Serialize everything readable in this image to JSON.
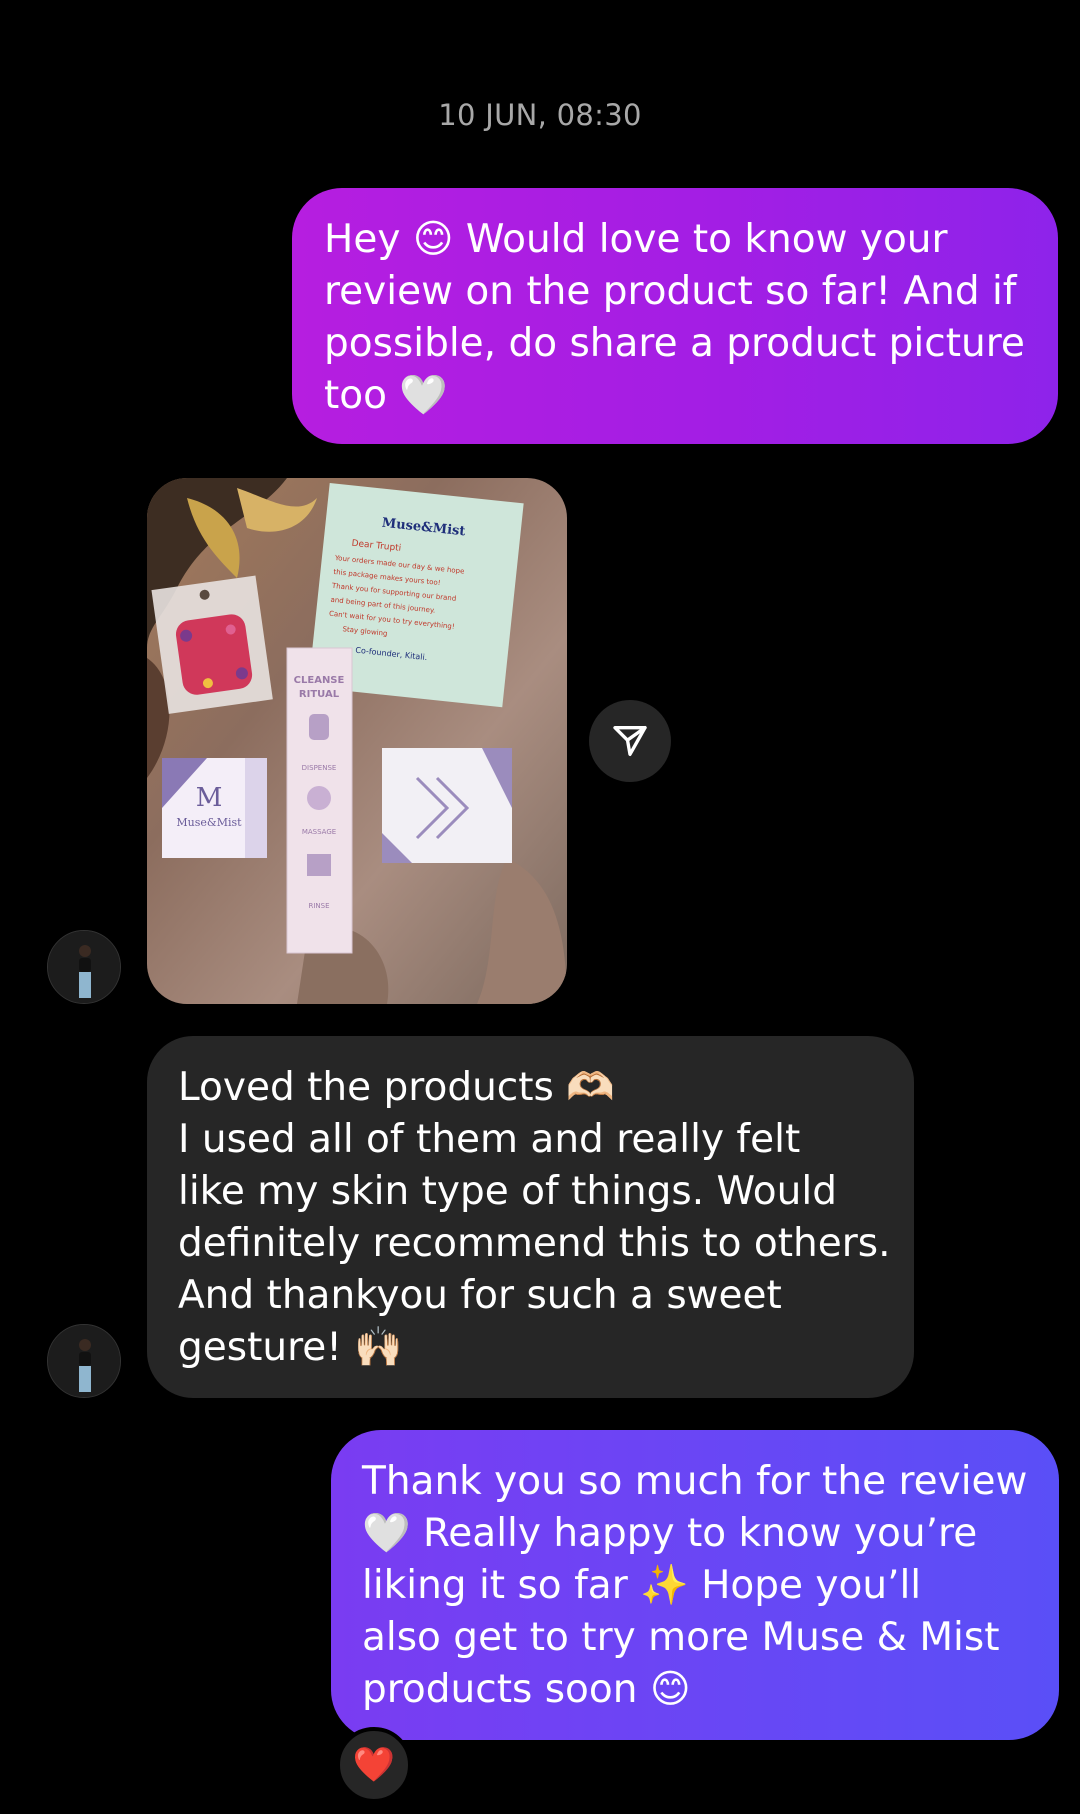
{
  "thread": {
    "timestamp": "10 JUN, 08:30"
  },
  "messages": [
    {
      "direction": "outgoing",
      "type": "text",
      "text": "Hey 😊 Would love to know your\nreview on the product so far! And if\npossible, do share a product picture\ntoo 🤍"
    },
    {
      "direction": "incoming",
      "type": "image"
    },
    {
      "direction": "incoming",
      "type": "text",
      "text": "Loved the products 🫶🏻\nI used all of them and really felt\nlike my skin type of things. Would\ndefinitely recommend this to others.\nAnd thankyou for such a sweet\ngesture! 🙌🏻"
    },
    {
      "direction": "outgoing",
      "type": "text",
      "text": "Thank you so much for the review\n🤍 Really happy to know you’re\nliking it so far ✨ Hope you’ll\nalso get to try more Muse & Mist\nproducts soon 😊",
      "reaction": "❤️"
    }
  ],
  "photo": {
    "brand_text": "Muse & Mist",
    "note_lines": [
      "Muse",
      "Mist",
      "Dear Trupti",
      "Your orders made our day",
      "Thank you for supporting",
      "our brand",
      "Can't wait for you to try",
      "Co-founder, Kitali"
    ],
    "box_text": [
      "CLEANSE",
      "RITUAL",
      "DISPENSE",
      "MASSAGE",
      "RINSE"
    ]
  },
  "colors": {
    "background": "#000000",
    "outgoing_bubble_1": "#a31ee4",
    "outgoing_bubble_2": "#6847f5",
    "incoming_bubble": "#262626",
    "timestamp": "#a8a8a8"
  },
  "icons": {
    "share": "paper-plane-outline-icon",
    "reaction": "heart"
  }
}
